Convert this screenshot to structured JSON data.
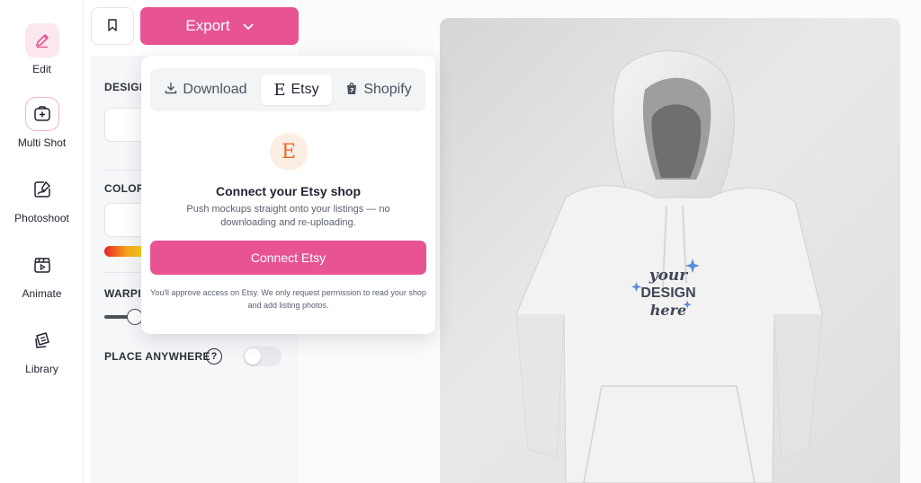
{
  "sidebar": {
    "items": [
      {
        "label": "Edit",
        "icon": "pencil-icon"
      },
      {
        "label": "Multi Shot",
        "icon": "add-shot-icon"
      },
      {
        "label": "Photoshoot",
        "icon": "photoshoot-icon"
      },
      {
        "label": "Animate",
        "icon": "clapperboard-icon"
      },
      {
        "label": "Library",
        "icon": "library-icon"
      }
    ]
  },
  "toolbar": {
    "bookmark_icon": "bookmark-icon",
    "export_label": "Export"
  },
  "panel": {
    "design_label": "DESIGN",
    "color_label": "COLOR",
    "warping_label": "WARPIN",
    "place_anywhere_label": "PLACE ANYWHERE",
    "help_glyph": "?"
  },
  "export_menu": {
    "tabs": [
      {
        "label": "Download",
        "icon": "download-icon"
      },
      {
        "label": "Etsy",
        "icon": "etsy-icon",
        "glyph": "E"
      },
      {
        "label": "Shopify",
        "icon": "shopify-icon"
      }
    ],
    "active_tab": "Etsy",
    "etsy_logo": "E",
    "title": "Connect your Etsy shop",
    "description": "Push mockups straight onto your listings — no downloading and re-uploading.",
    "connect_button": "Connect Etsy",
    "note": "You'll approve access on Etsy. We only request permission to read your shop and add listing photos."
  },
  "mockup": {
    "design_text_line1": "your",
    "design_text_line2": "DESIGN",
    "design_text_line3": "here"
  },
  "colors": {
    "accent": "#e85493",
    "etsy_orange": "#ec6b2a",
    "active_rail_bg": "#fde7ef"
  }
}
